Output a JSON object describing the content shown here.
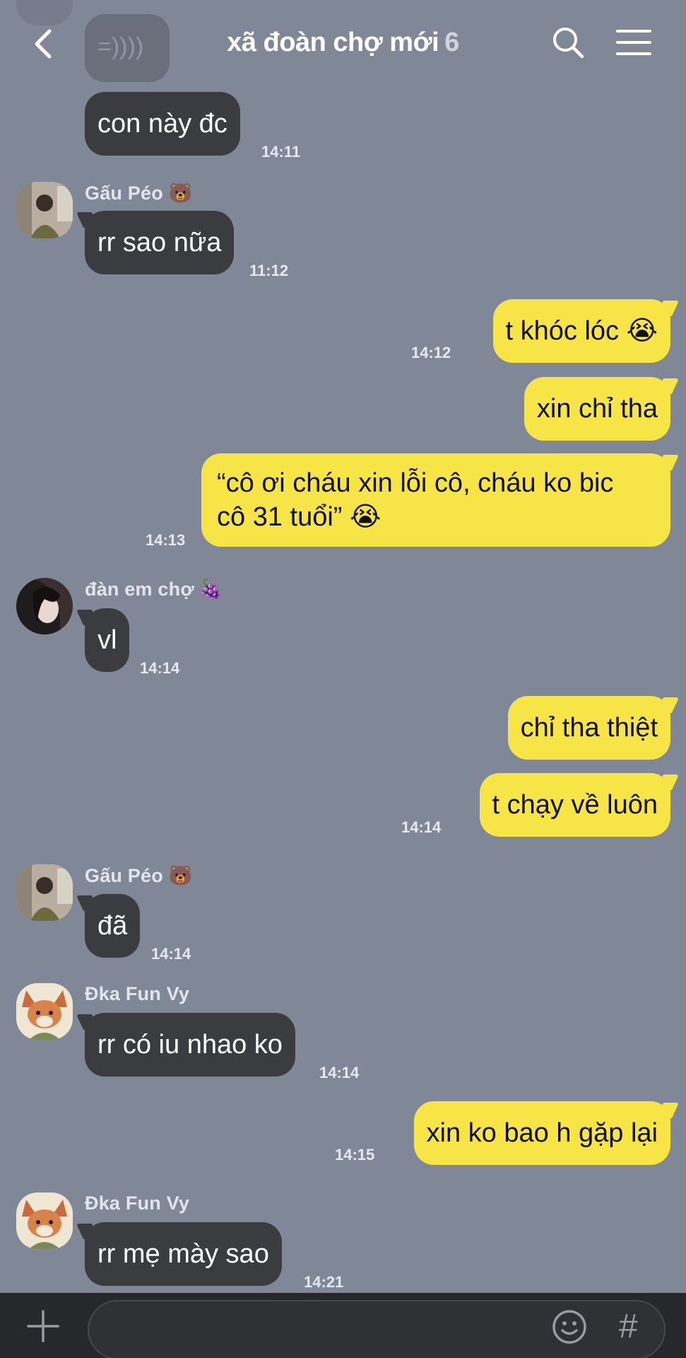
{
  "header": {
    "title": "xã đoàn chợ mới",
    "count": "6"
  },
  "partial_top": {
    "voice_glyph": "=))))"
  },
  "messages": {
    "m1": {
      "text": "con này đc",
      "time": "14:11"
    },
    "m2": {
      "sender": "Gấu Péo 🐻",
      "text": "rr sao nữa",
      "time": "11:12"
    },
    "m3": {
      "text": "t khóc lóc 😭",
      "time": "14:12"
    },
    "m4": {
      "text": "xin chỉ tha"
    },
    "m5": {
      "line1": "“cô ơi cháu xin lỗi cô, cháu ko bic",
      "line2": "cô 31 tuổi” 😭",
      "time": "14:13"
    },
    "m6": {
      "sender": "đàn em chợ 🍇",
      "text": "vl",
      "time": "14:14"
    },
    "m7": {
      "text": "chỉ tha thiệt"
    },
    "m8": {
      "text": "t chạy về luôn",
      "time": "14:14"
    },
    "m9": {
      "sender": "Gấu Péo 🐻",
      "text": "đã",
      "time": "14:14"
    },
    "m10": {
      "sender": "Đka Fun Vy",
      "text": "rr có iu nhao ko",
      "time": "14:14"
    },
    "m11": {
      "text": "xin ko bao h gặp lại",
      "time": "14:15"
    },
    "m12": {
      "sender": "Đka Fun Vy",
      "text": "rr mẹ mày sao",
      "time": "14:21"
    }
  },
  "composer": {
    "hash_label": "#"
  },
  "colors": {
    "background": "#808898",
    "incoming_bubble": "#3b3c40",
    "outgoing_bubble": "#f7e548",
    "bottom_bar": "#27282b"
  },
  "icons": {
    "back": "chevron-left-icon",
    "search": "search-icon",
    "menu": "hamburger-menu-icon",
    "plus": "plus-icon",
    "emoji": "smiley-icon"
  }
}
